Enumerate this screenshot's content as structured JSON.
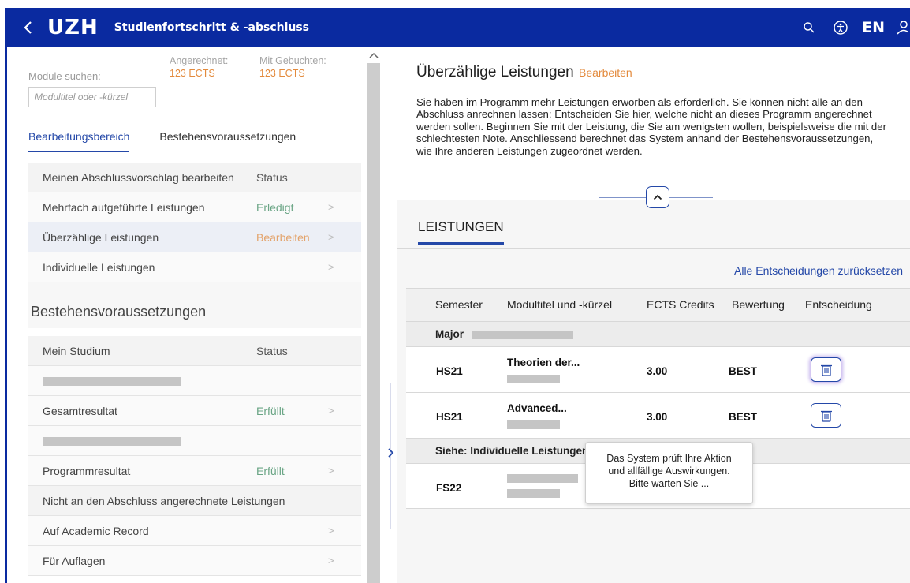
{
  "header": {
    "back_icon": "chevron-left-icon",
    "logo": "UZH",
    "title": "Studienfortschritt & -abschluss",
    "icons": [
      "search-icon",
      "accessibility-icon",
      "user-icon"
    ],
    "language": "EN",
    "bg_color": "#0a2aa0"
  },
  "sidebar": {
    "search_label": "Module suchen:",
    "search_placeholder": "Modultitel oder -kürzel",
    "ects": {
      "credited_label": "Angerechnet:",
      "credited_value": "123 ECTS",
      "booked_label": "Mit Gebuchten:",
      "booked_value": "123 ECTS"
    },
    "tabs": [
      {
        "label": "Bearbeitungsbereich",
        "active": true
      },
      {
        "label": "Bestehensvoraussetzungen",
        "active": false
      }
    ],
    "edit_section": {
      "header_name": "Meinen Abschlussvorschlag bearbeiten",
      "header_status": "Status",
      "items": [
        {
          "name": "Mehrfach aufgeführte Leistungen",
          "status": "Erledigt"
        },
        {
          "name": "Überzählige Leistungen",
          "status": "Bearbeiten",
          "selected": true
        },
        {
          "name": "Individuelle Leistungen",
          "status": ""
        }
      ]
    },
    "requirements_title": "Bestehensvoraussetzungen",
    "study": {
      "header_name": "Mein Studium",
      "header_status": "Status",
      "items": [
        {
          "name": "Gesamtresultat",
          "status": "Erfüllt"
        },
        {
          "name": "Programmresultat",
          "status": "Erfüllt"
        }
      ]
    },
    "not_credited": {
      "header_name": "Nicht an den Abschluss angerechnete Leistungen",
      "items": [
        {
          "name": "Auf Academic Record"
        },
        {
          "name": "Für Auflagen"
        }
      ]
    }
  },
  "main": {
    "title": "Überzählige Leistungen",
    "edit_label": "Bearbeiten",
    "description": "Sie haben im Programm mehr Leistungen erworben als erforderlich. Sie können nicht alle an den Abschluss anrechnen lassen: Entscheiden Sie hier, welche nicht an dieses Programm angerechnet werden sollen. Beginnen Sie mit der Leistung, die Sie am wenigsten wollen, beispielsweise die mit der schlechtesten Note. Anschliessend berechnet das System anhand der Bestehensvoraussetzungen, wie Ihre anderen Leistungen zugeordnet werden.",
    "tab": "LEISTUNGEN",
    "reset_link": "Alle Entscheidungen zurücksetzen",
    "table": {
      "columns": [
        "Semester",
        "Modultitel und -kürzel",
        "ECTS Credits",
        "Bewertung",
        "Entscheidung"
      ],
      "group_major": "Major",
      "rows": [
        {
          "semester": "HS21",
          "module": "Theorien der...",
          "ects": "3.00",
          "grade": "BEST",
          "action_icon": "trash-icon"
        },
        {
          "semester": "HS21",
          "module": "Advanced...",
          "ects": "3.00",
          "grade": "BEST",
          "action_icon": "trash-icon"
        }
      ],
      "group_individual": "Siehe: Individuelle Leistungen",
      "individual_rows": [
        {
          "semester": "FS22"
        }
      ]
    },
    "tooltip": "Das System  prüft Ihre Aktion und allfällige Auswirkungen. Bitte warten Sie ..."
  },
  "colors": {
    "accent": "#2448a8",
    "done": "#6aa585",
    "edit": "#e38a3c"
  }
}
